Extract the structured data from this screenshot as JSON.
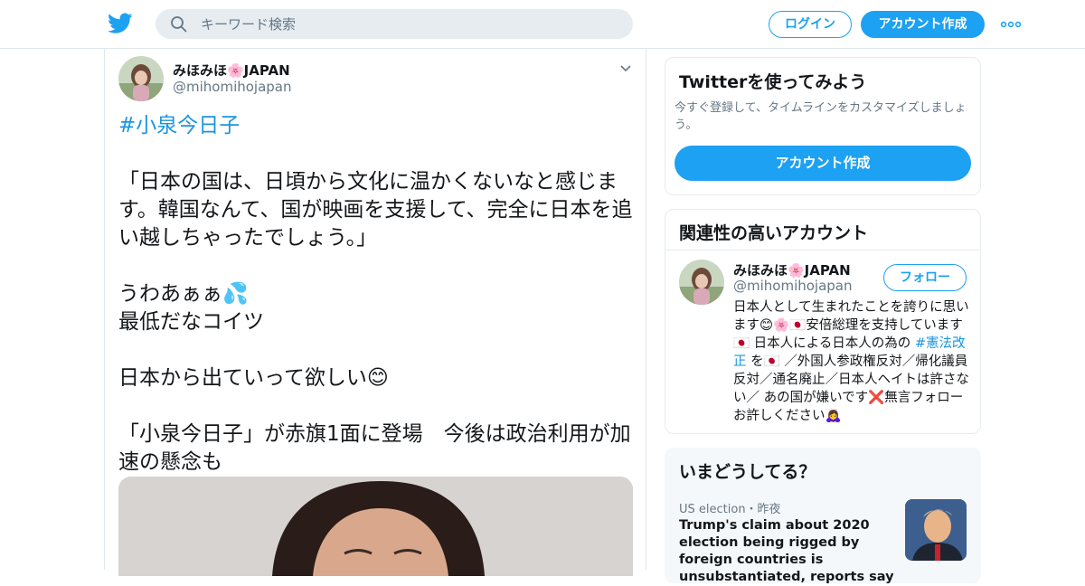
{
  "header": {
    "search_placeholder": "キーワード検索",
    "login_label": "ログイン",
    "signup_label": "アカウント作成"
  },
  "tweet": {
    "display_name": "みほみほ🌸JAPAN",
    "handle": "@mihomihojapan",
    "hashtag": "#小泉今日子",
    "quote": "「日本の国は、日頃から文化に温かくないなと感じます。韓国なんて、国が映画を支援して、完全に日本を追い越しちゃったでしょう。」",
    "line_wow": "うわあぁぁ",
    "emoji_sweat": "💦",
    "line_worst": "最低だなコイツ",
    "line_leave": "日本から出ていって欲しい",
    "emoji_smile": "😊",
    "headline": "「小泉今日子」が赤旗1面に登場　今後は政治利用が加速の懸念も"
  },
  "sidebar": {
    "try_card": {
      "title": "Twitterを使ってみよう",
      "subtitle": "今すぐ登録して、タイムラインをカスタマイズしましょう。",
      "signup_label": "アカウント作成"
    },
    "related_card": {
      "title": "関連性の高いアカウント",
      "display_name": "みほみほ🌸JAPAN",
      "handle": "@mihomihojapan",
      "follow_label": "フォロー",
      "bio_part1": "日本人として生まれたことを誇りに思います😊🌸🇯🇵安倍総理を支持しています🇯🇵 日本人による日本人の為の ",
      "bio_hashtag": "#憲法改正",
      "bio_part2": " を🇯🇵 ／外国人参政権反対／帰化議員反対／通名廃止／日本人ヘイトは許さない／ あの国が嫌いです❌無言フォローお許しください🙇‍♀️"
    },
    "trends_card": {
      "title": "いまどうしてる？",
      "meta": "US election・昨夜",
      "text": "Trump's claim about 2020 election being rigged by foreign countries is unsubstantiated, reports say"
    }
  },
  "colors": {
    "brand_blue": "#1da1f2",
    "hashtag_blue": "#1b95e0",
    "muted_gray": "#657786",
    "border": "#e1e8ed"
  },
  "icons": [
    "twitter-logo-icon",
    "search-icon",
    "more-icon",
    "chevron-down-icon"
  ]
}
